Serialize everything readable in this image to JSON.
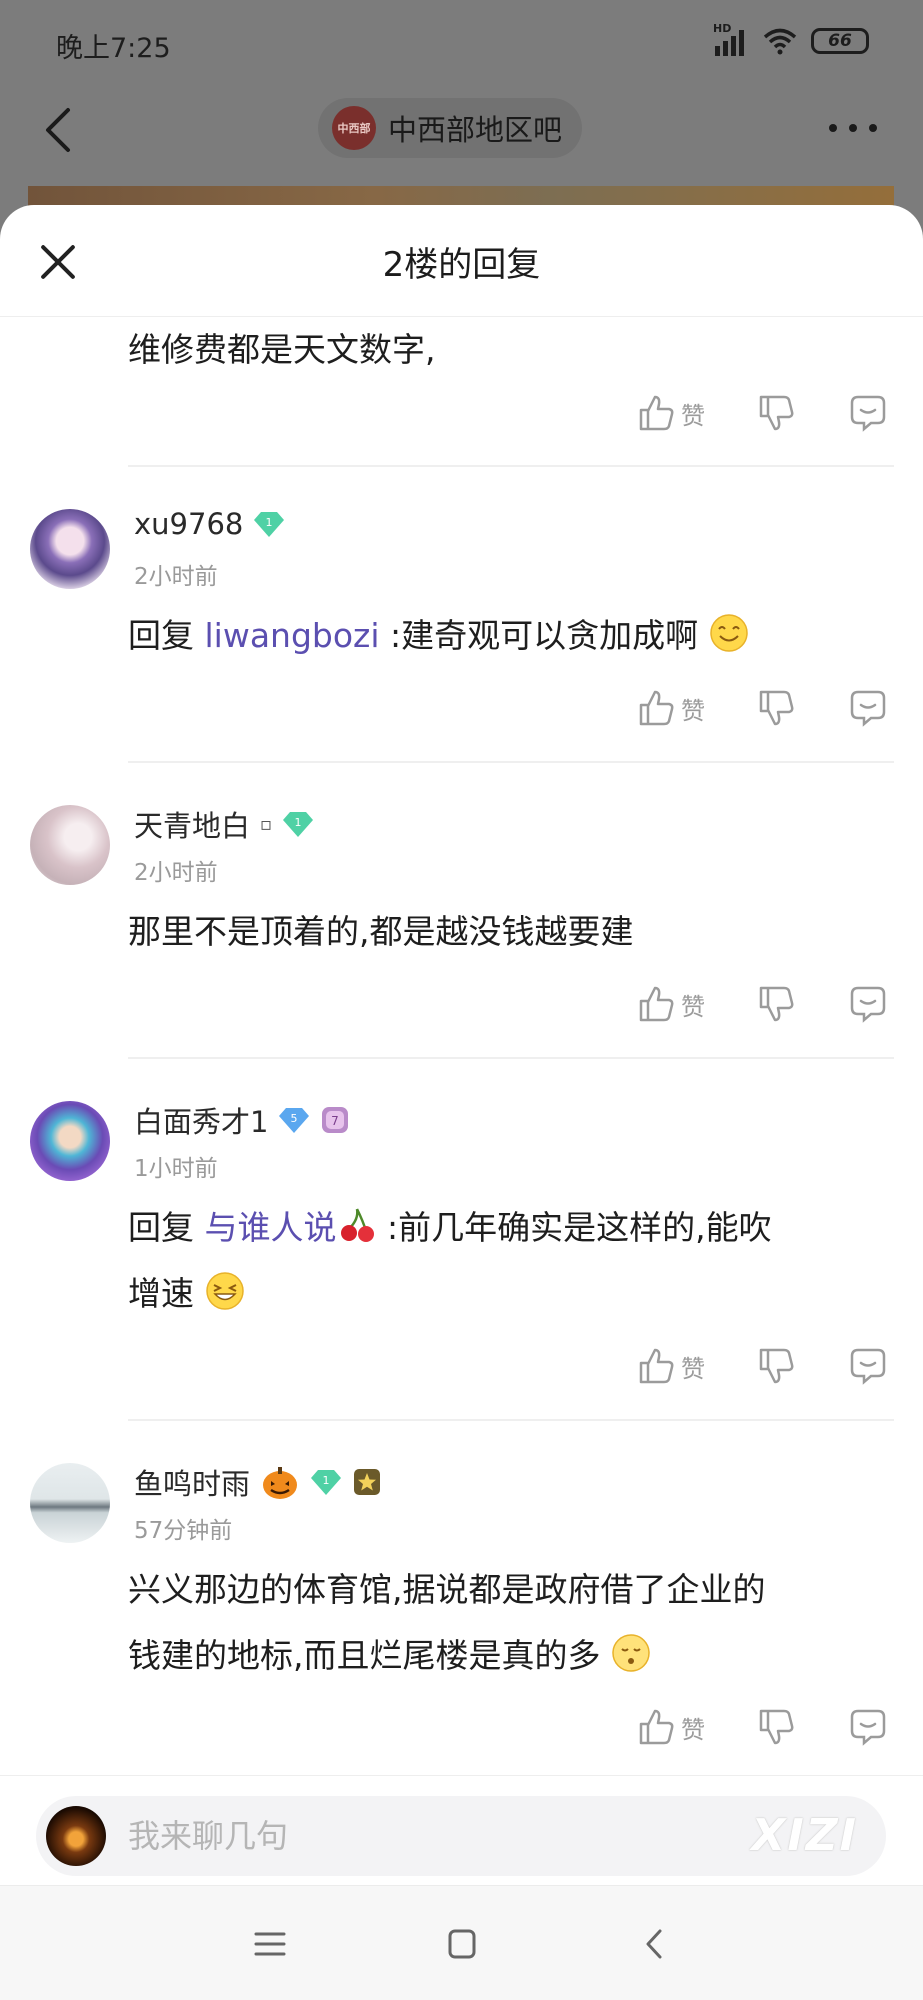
{
  "status_bar": {
    "time": "晚上7:25",
    "network": "HD",
    "battery": "66"
  },
  "nav": {
    "forum_name": "中西部地区吧",
    "forum_logo_text": "中西部"
  },
  "sheet": {
    "title": "2楼的回复",
    "first_comment_text": "维修费都是天文数字,"
  },
  "actions": {
    "like_label": "赞"
  },
  "comments": [
    {
      "username": "xu9768",
      "time": "2小时前",
      "gem_level": "1",
      "reply_prefix": "回复",
      "mention": "liwangbozi",
      "text": ":建奇观可以贪加成啊"
    },
    {
      "username": "天青地白",
      "username_suffix": "▫",
      "time": "2小时前",
      "gem_level": "1",
      "text": "那里不是顶着的,都是越没钱越要建"
    },
    {
      "username": "白面秀才1",
      "time": "1小时前",
      "gem_level": "5",
      "lv_badge": "7",
      "reply_prefix": "回复",
      "mention": "与谁人说",
      "text_line1": ":前几年确实是这样的,能吹",
      "text_line2": "增速"
    },
    {
      "username": "鱼鸣时雨",
      "time": "57分钟前",
      "gem_level": "1",
      "text_line1": "兴义那边的体育馆,据说都是政府借了企业的",
      "text_line2": "钱建的地标,而且烂尾楼是真的多"
    }
  ],
  "input": {
    "placeholder": "我来聊几句",
    "watermark": "XIZI"
  },
  "colors": {
    "mention": "#5b4fb0",
    "gem_green": "#4fd1a5",
    "gem_blue": "#5aa7ef"
  }
}
